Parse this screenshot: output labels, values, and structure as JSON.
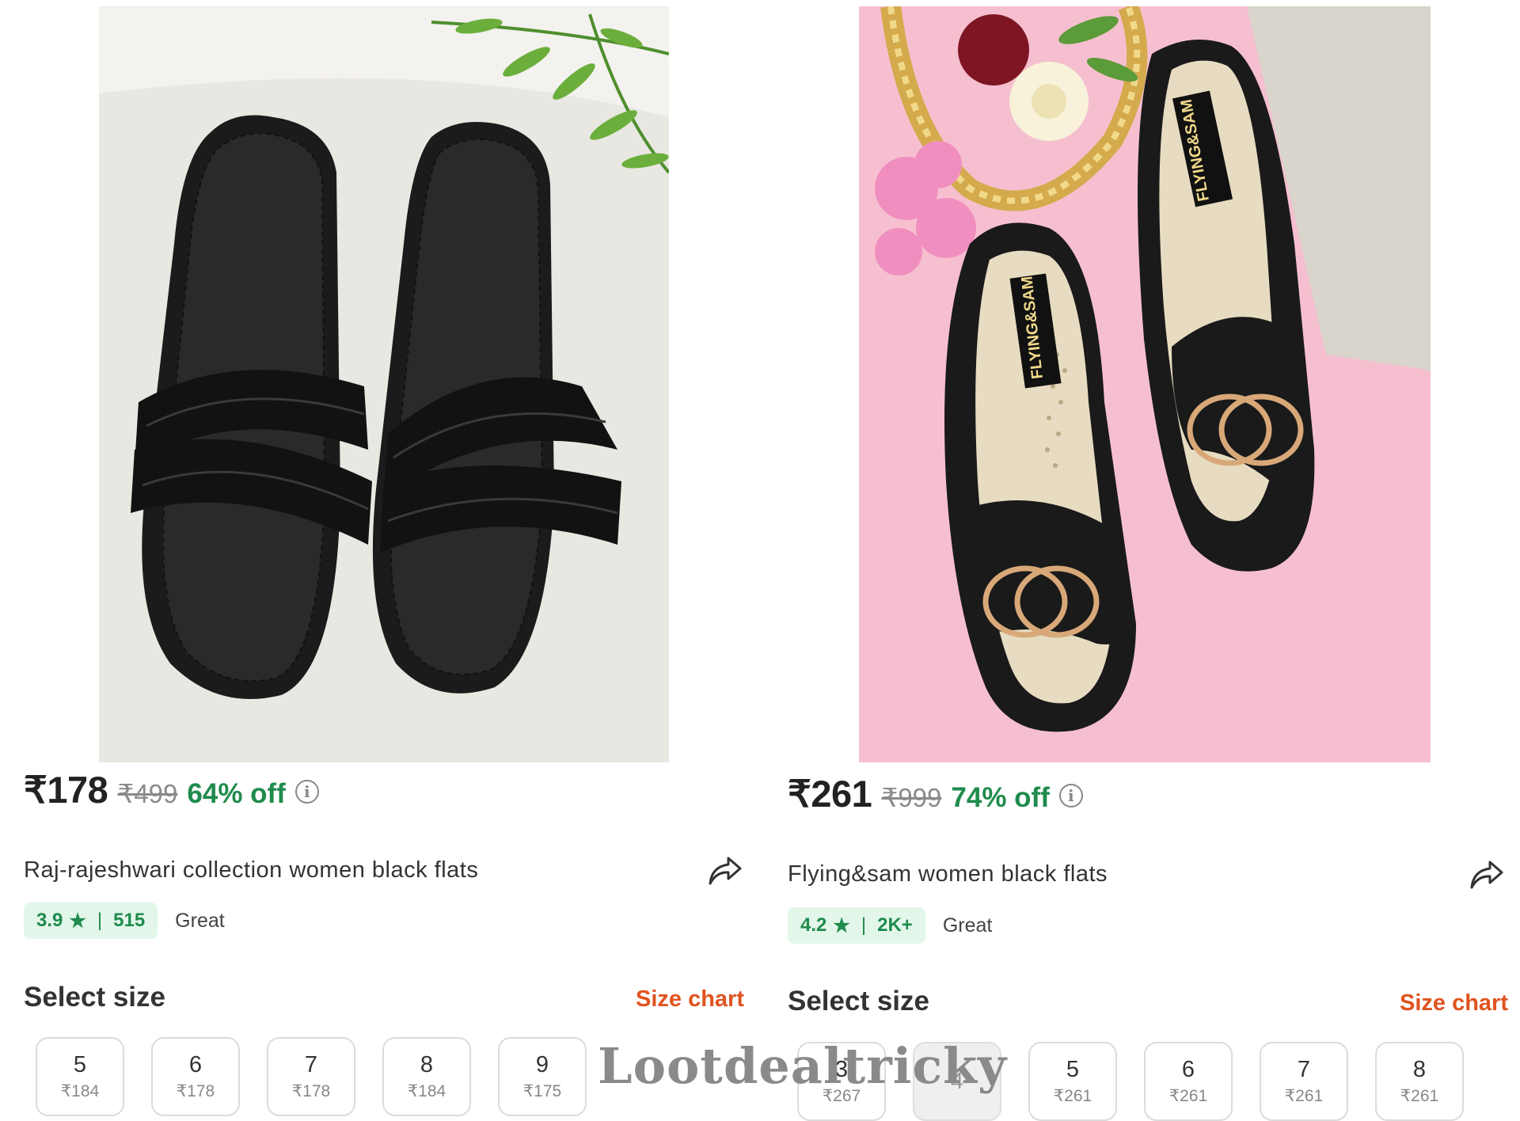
{
  "products": [
    {
      "price": "₹178",
      "mrp": "₹499",
      "discount": "64% off",
      "title": "Raj-rajeshwari collection women black flats",
      "rating": "3.9",
      "reviews": "515",
      "rating_label": "Great",
      "select_size_label": "Select size",
      "size_chart_label": "Size chart",
      "sizes": [
        {
          "size": "5",
          "price": "₹184"
        },
        {
          "size": "6",
          "price": "₹178"
        },
        {
          "size": "7",
          "price": "₹178"
        },
        {
          "size": "8",
          "price": "₹184"
        },
        {
          "size": "9",
          "price": "₹175"
        }
      ]
    },
    {
      "price": "₹261",
      "mrp": "₹999",
      "discount": "74% off",
      "title": "Flying&sam women black flats",
      "rating": "4.2",
      "reviews": "2K+",
      "rating_label": "Great",
      "select_size_label": "Select size",
      "size_chart_label": "Size chart",
      "brand_on_insole": "FLYING&SAM",
      "sizes": [
        {
          "size": "3",
          "price": "₹267"
        },
        {
          "size": "4",
          "price": ""
        },
        {
          "size": "5",
          "price": "₹261"
        },
        {
          "size": "6",
          "price": "₹261"
        },
        {
          "size": "7",
          "price": "₹261"
        },
        {
          "size": "8",
          "price": "₹261"
        }
      ]
    }
  ],
  "watermark": "Lootdealtricky",
  "colors": {
    "discount_green": "#1f8b4c",
    "rating_bg": "#e3f6ea",
    "size_chart_orange": "#e0531f"
  }
}
